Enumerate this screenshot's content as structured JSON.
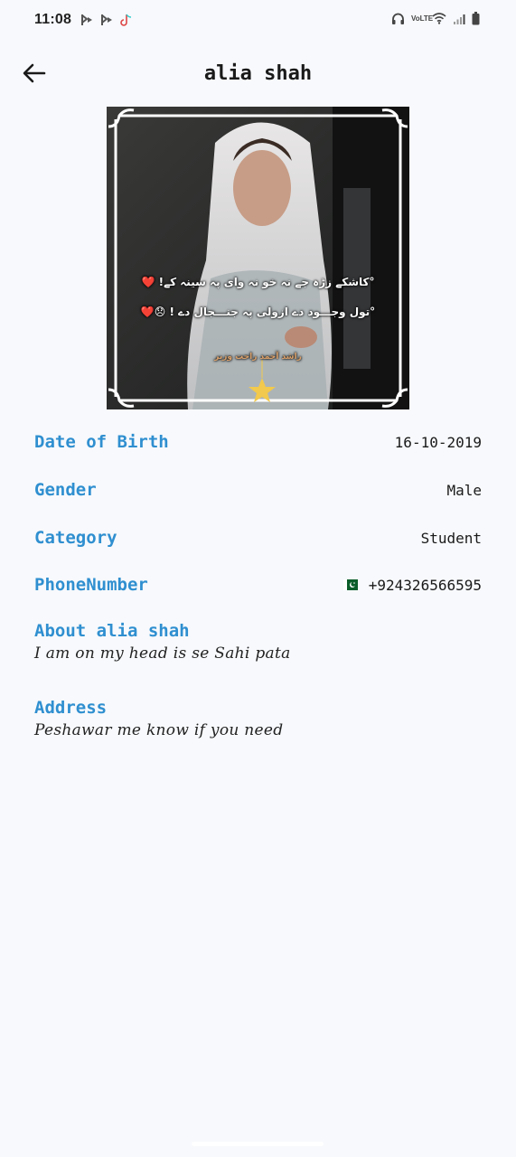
{
  "status_bar": {
    "time": "11:08",
    "left_icons": [
      "app-notification-icon",
      "app-notification-icon",
      "tiktok-icon"
    ],
    "right_icons": [
      "headphones-icon",
      "volte-icon",
      "wifi-icon",
      "signal-icon",
      "battery-icon"
    ],
    "volte_label": "VoLTE"
  },
  "appbar": {
    "title": "alia shah"
  },
  "photo": {
    "overlay_line1": "°کاشکے زڑہ جے نہ خو نہ وای پہ سینہ کے! ❤️",
    "overlay_line2": "°تول وجـــود دے ازولی پہ جنـــجال دے ! 😞❤️",
    "signature": "راشد آحمد راحت وزیر"
  },
  "details": {
    "dob_label": "Date of Birth",
    "dob_value": "16-10-2019",
    "gender_label": "Gender",
    "gender_value": "Male",
    "category_label": "Category",
    "category_value": "Student",
    "phone_label": "PhoneNumber",
    "phone_value": "+924326566595",
    "phone_flag": "pakistan-flag-icon"
  },
  "about": {
    "label": "About alia shah",
    "text": "I am on my head is se Sahi pata"
  },
  "address": {
    "label": "Address",
    "text": "Peshawar me know if you need"
  },
  "colors": {
    "accent": "#2f8fd0",
    "background": "#f7f9fc",
    "text": "#1a1a1a"
  }
}
